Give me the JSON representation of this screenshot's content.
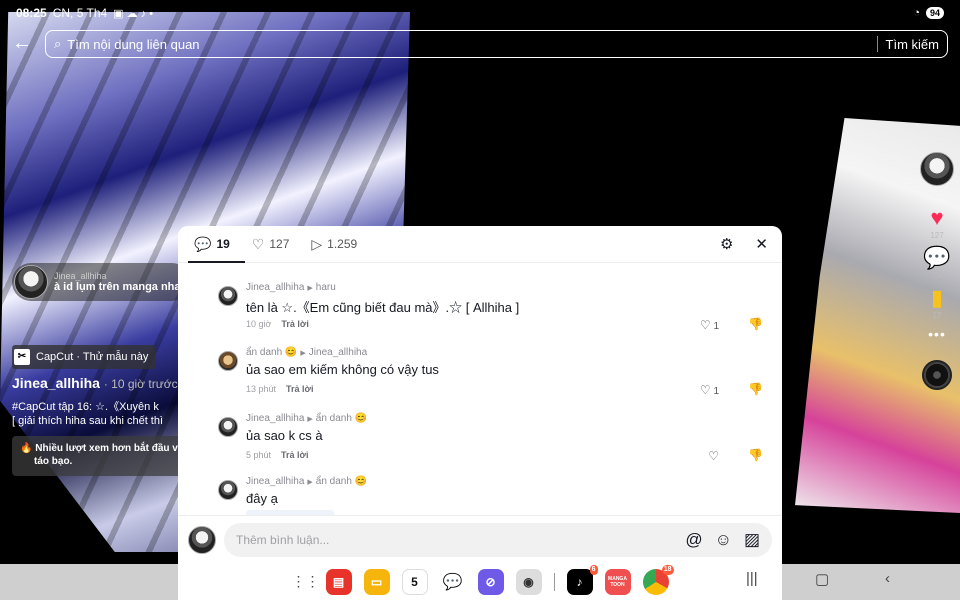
{
  "status_bar": {
    "time": "08:25",
    "date": "CN, 5 Th4",
    "battery": "94"
  },
  "search": {
    "placeholder": "Tìm nội dung liên quan",
    "button": "Tìm kiếm"
  },
  "video_overlay": {
    "top_comment_user": "Jinea_allhiha",
    "top_comment_text": "à id lụm trên manga nha",
    "capcut_label": "CapCut · Thử mẫu này",
    "author": "Jinea_allhiha",
    "posted": "· 10 giờ trước",
    "caption_line1": "#CapCut tập 16: ☆.《Xuyên k",
    "caption_line2": "[ giải thích hiha sau khi chết thì",
    "promo_line1": "Nhiều lượt xem hơn bắt đầu v",
    "promo_line2": "táo bạo."
  },
  "right_rail": {
    "likes": "127",
    "comments": "19",
    "saves": "17"
  },
  "panel": {
    "tabs": [
      {
        "label": "19"
      },
      {
        "label": "127"
      },
      {
        "label": "1.259"
      }
    ],
    "comments": [
      {
        "user": "Jinea_allhiha",
        "reply_to": "haru",
        "text": "tên là ☆.《Em cũng biết đau mà》.☆ [ Allhiha ]",
        "time": "10 giờ",
        "reply": "Trả lời",
        "likes": "1"
      },
      {
        "user": "ẩn danh 😊",
        "reply_to": "Jinea_allhiha",
        "text": "ủa sao em kiếm không có vậy tus",
        "time": "13 phút",
        "reply": "Trả lời",
        "likes": "1"
      },
      {
        "user": "Jinea_allhiha",
        "reply_to": "ẩn danh 😊",
        "text": "ủa sao k cs à",
        "time": "5 phút",
        "reply": "Trả lời",
        "likes": ""
      },
      {
        "user": "Jinea_allhiha",
        "reply_to": "ẩn danh 😊",
        "text": "đây ạ"
      }
    ],
    "composer_placeholder": "Thêm bình luận..."
  },
  "dock": {
    "calendar_day": "5",
    "tiktok_badge": "6",
    "manga_label": "MANGA TOON",
    "chrome_badge": "18"
  },
  "colors": {
    "like": "#ff2b55",
    "bookmark": "#f7c21b",
    "badge": "#ff5a3c"
  }
}
